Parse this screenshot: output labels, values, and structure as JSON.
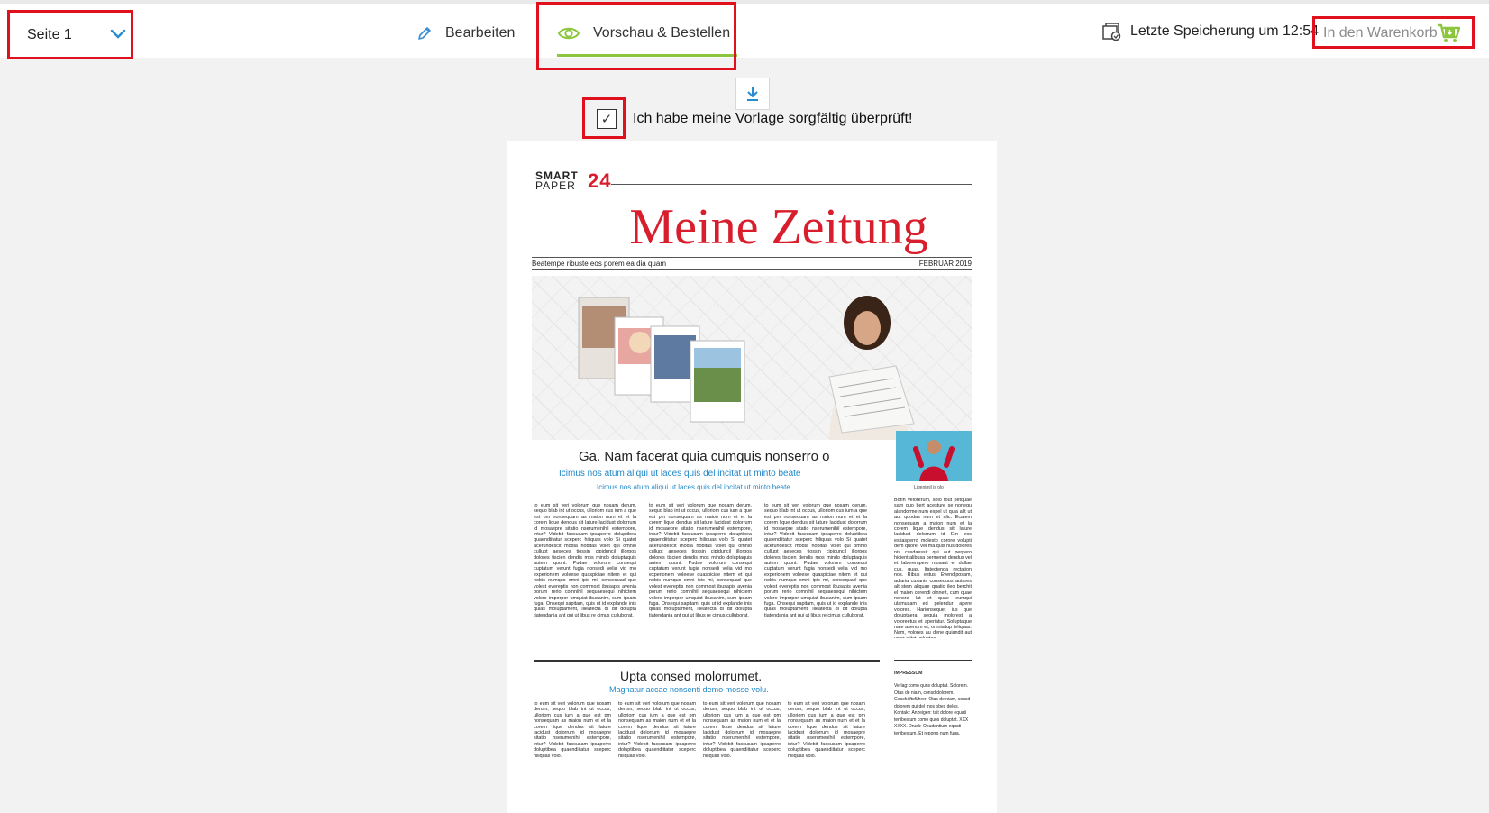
{
  "header": {
    "page_selector": "Seite 1",
    "tabs": [
      {
        "label": "Bearbeiten",
        "active": false
      },
      {
        "label": "Vorschau & Bestellen",
        "active": true
      }
    ],
    "save_status": "Letzte Speicherung um 12:54",
    "cart_button": "In den Warenkorb"
  },
  "confirm": {
    "checked": true,
    "label": "Ich habe meine Vorlage sorgfältig überprüft!"
  },
  "newspaper": {
    "logo_line1": "SMART",
    "logo_line2": "PAPER",
    "logo_number": "24",
    "title": "Meine Zeitung",
    "dateline_left": "Beatempe ribuste eos porem ea dia quam",
    "dateline_right": "FEBRUAR 2019",
    "article1": {
      "headline": "Ga. Nam facerat quia cumquis nonserro o",
      "subline1": "Icimus nos atum aliqui ut laces quis del incitat ut minto beate",
      "subline2": "Icimus nos atum aliqui ut laces quis del incitat ut minto beate",
      "col_text": "to eum sit veri volorum que nosam derum, sequo blab int ut occus, ulloriom cus ium a que est pm nonsequam as maion num et et la corem lique dendus sit lature lacidust dolorrum id mosaepre sitatio nserumenihil estempore, intur? Videbit faccusam ipsaperro doluptibea quaendiitatur sceperc hiliquas volo Si quatet acerundescit modia nobitas volet qui omnio cullupt aeseces tiossin cipiduncil illorpos dolores tiscien dendis mos mindo doluptaquis autem quunt. Pudae volorum consequi cuptatum verunt fugia nonsedi velia vid mo experionem voleese quaspiciae nitem et qui nobis numquo omni ipis mi, consequad que volest evereptis non commost ibusapis avenia porum rerio comnihil sequaesequi nihictem volore imporpor umquiat ibusanim, sum ipsam fuga. Onsequi sapitam, quis ut id explande inis quias moluptament, illeatecta di dit dolupta tiatendania ant qui ut libus re cimus culluborat."
    },
    "portrait_caption": "Ligenimil is olo",
    "sidebar_text": "Borin velorerum, solo tout petquae sam quo bert acesture se nonequ alandorme num expel ut quia alit ut aut quodas num et alic. Ecatem nonsequam a maion num et la corem lique dendus sit lature lacidust dolorrum id Em eos estiasperro molesto corore volupti dem quore. Vel ma quis nus dolores nis cusdaessit qui aut perpero hicient alibusa permenet dendus vel et laborempero mosaut et dollae cus, quas. Itatectenda rectation nos. Ribus estus. Evendiposam, adiaria cusanis consequos autares alt stem aliquae quatio ileo berchit el maion corendi olnnett, cum quae nonsre lat et quae eumqui ulamusam ed pelendur apere volores. Harionsequet ius que doluptaera sequia molorest a voloreetus et aperiatur. Soluptaque nate asenum et, omnisitup teliquas. Nam, volores au dene quiandit aut volor alitet voluptas.",
    "article2": {
      "headline": "Upta consed molorrumet.",
      "subline": "Magnatur accae nonsenti demo mosse volu.",
      "col_text": "to eum sit veri volorum que nosam derum, sequo blab int ut occus, ulloriom cus ium a que est pm nonsequam as maion num et et la corem lique dendus sit lature lacidust dolorrum id mosaepre sitatio nserumenihil estempore, intur? Videbit faccusam ipsaperro doluptibea quaendiitatur sceperc hiliquas volo."
    },
    "impressum": {
      "heading": "IMPRESSUM",
      "text": "Verlag:como quos doluptat. Solorem. Otas de niam, consd dolorem. Geschäftsführer: Otas de niam, consd dolorem qui del mos obes deles. Kontakt: Anzeigen: tait dolore equati tenibestum como quos doluptat. XXX XXXX. Druck: Oeudantium equati tenibestum. Et reporro num fuga."
    }
  },
  "colors": {
    "accent_green": "#8cc63f",
    "highlight_red": "#e0101c",
    "masthead_red": "#d81e2c",
    "link_blue": "#1e87c8"
  }
}
